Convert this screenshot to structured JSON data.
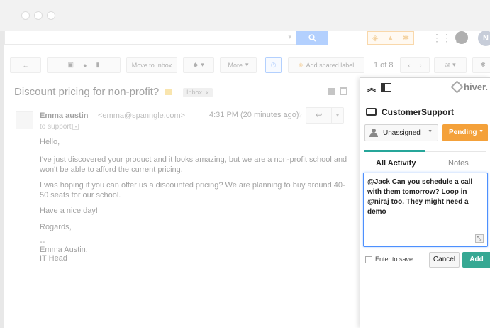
{
  "gmail": {
    "search_button_icon": "search-icon",
    "avatar_initial": "N",
    "toolbar": {
      "move_to_inbox": "Move to Inbox",
      "more": "More",
      "add_shared_label": "Add shared label",
      "pager": "1 of 8",
      "language": "अ"
    },
    "email": {
      "subject": "Discount pricing for non-profit?",
      "label": "Inbox",
      "label_close": "x",
      "sender_name": "Emma austin",
      "sender_email": "<emma@spanngle.com>",
      "time": "4:31 PM (20 minutes ago)",
      "to_line": "to support",
      "body": [
        "Hello,",
        "I've just discovered your product and it looks amazing, but we are a non-profit school and",
        "won't be able to afford the current pricing.",
        "I was hoping if you can offer us a discounted pricing? We are planning to buy around 40-",
        "50 seats for our school.",
        "Have a nice day!",
        "Rogards,",
        "--",
        "Emma Austin,",
        "IT Head"
      ]
    }
  },
  "hiver": {
    "logo_text": "hiver.",
    "mailbox": "CustomerSupport",
    "assignee": "Unassigned",
    "status": "Pending",
    "status_color": "#f4a13a",
    "accent_color": "#26a69a",
    "tabs": [
      "All Activity",
      "Notes"
    ],
    "note_text": "@Jack Can you schedule a call with them tomorrow? Loop in @niraj too. They might need a demo",
    "enter_to_save": "Enter to save",
    "cancel": "Cancel",
    "add": "Add"
  }
}
